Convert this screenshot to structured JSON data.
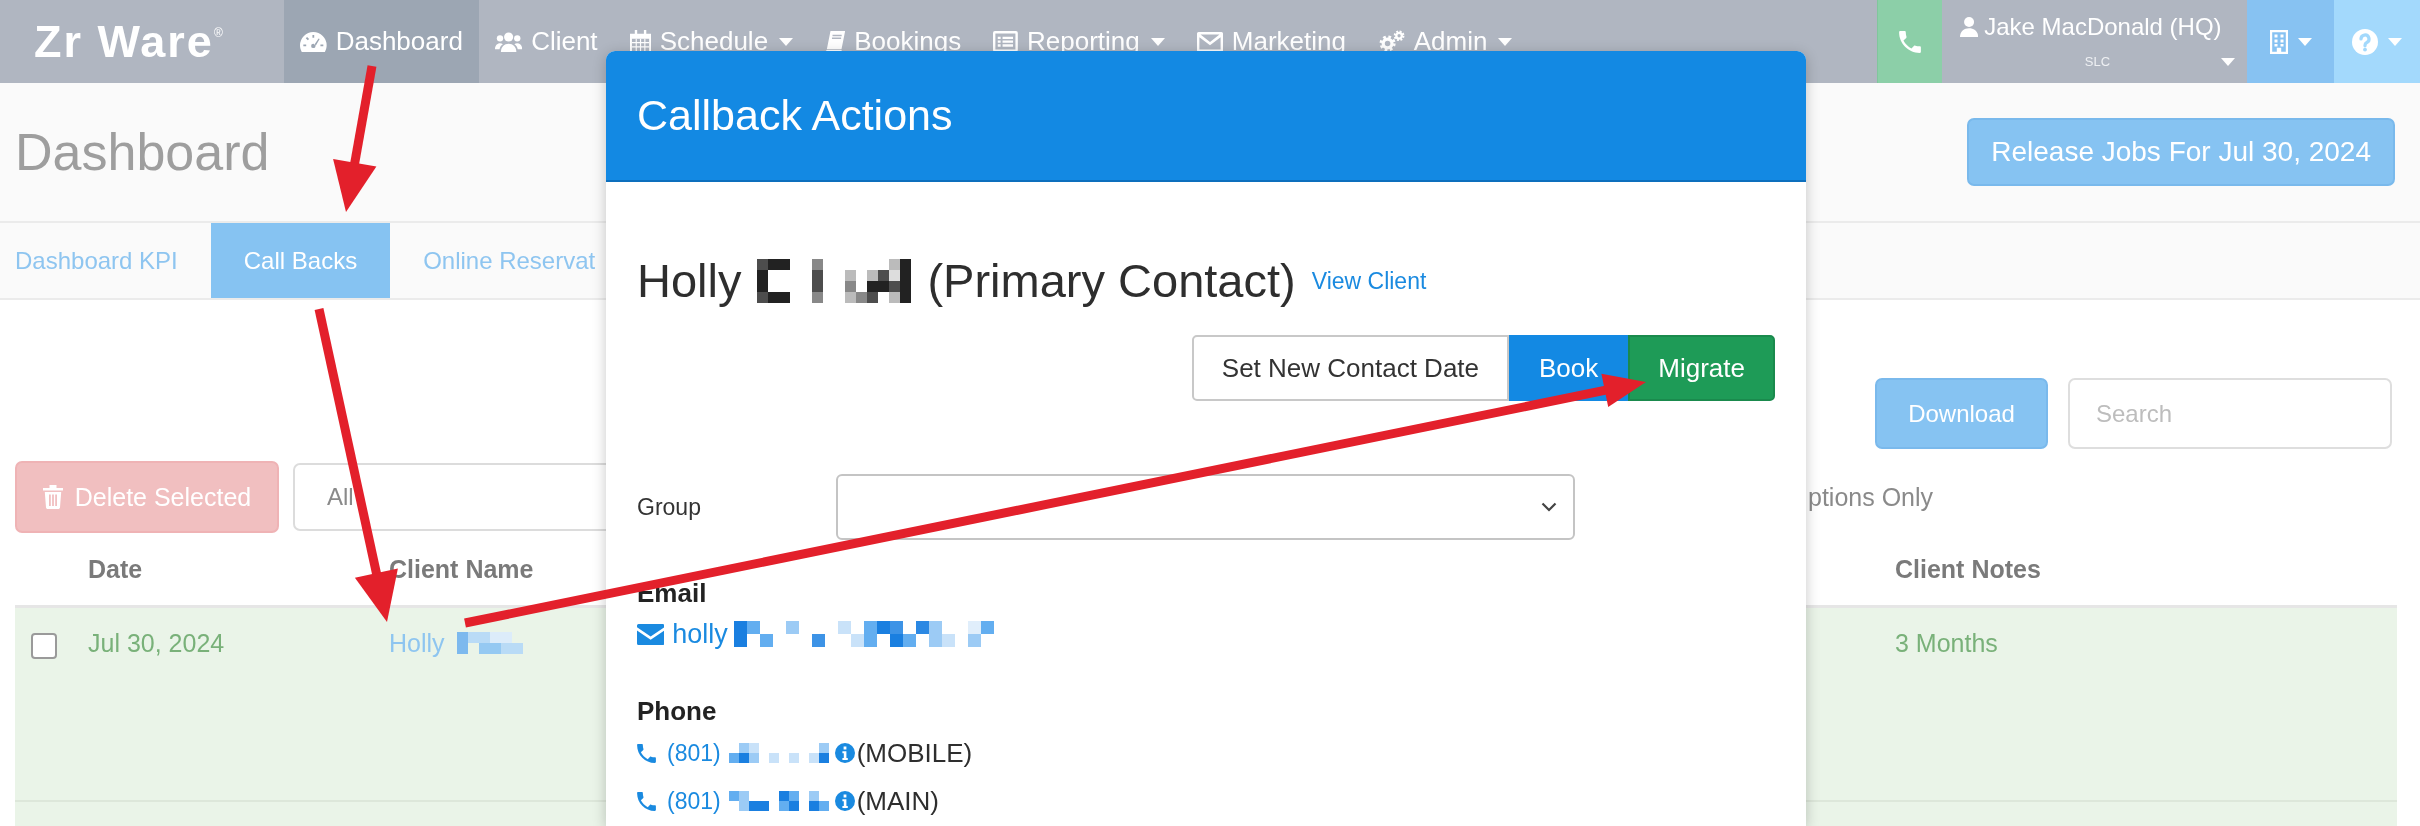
{
  "navbar": {
    "brand": "Zr Ware$^{®}$",
    "items": [
      {
        "label": "Dashboard",
        "selected": true,
        "dropdown": false
      },
      {
        "label": "Client",
        "selected": false,
        "dropdown": false
      },
      {
        "label": "Schedule",
        "selected": false,
        "dropdown": true
      },
      {
        "label": "Bookings",
        "selected": false,
        "dropdown": false
      },
      {
        "label": "Reporting",
        "selected": false,
        "dropdown": true
      },
      {
        "label": "Marketing",
        "selected": false,
        "dropdown": false
      },
      {
        "label": "Admin",
        "selected": false,
        "dropdown": true
      }
    ],
    "user": {
      "name": "Jake MacDonald (HQ)",
      "location": "SLC"
    }
  },
  "page": {
    "title": "Dashboard",
    "release_button": "Release Jobs For Jul 30, 2024"
  },
  "tabs": [
    {
      "label": "Dashboard KPI",
      "selected": false
    },
    {
      "label": "Call Backs",
      "selected": true
    },
    {
      "label": "Online Reservat",
      "selected": false
    }
  ],
  "toolbar": {
    "download_button": "Download",
    "search": {
      "placeholder": "Search"
    },
    "delete_button": "Delete Selected",
    "filter": {
      "value": "All"
    },
    "option_label": "ptions Only"
  },
  "table": {
    "columns": [
      "Date",
      "Client Name",
      "Client Notes"
    ],
    "rows": [
      {
        "checked": false,
        "date": "Jul 30, 2024",
        "client_name": "Holly",
        "redacted": true,
        "client_notes": "3 Months"
      }
    ]
  },
  "modal": {
    "title": "Callback Actions",
    "contact": {
      "first_name": "Holly",
      "redacted": true,
      "role": "(Primary Contact)"
    },
    "view_client_link": "View Client",
    "buttons": [
      {
        "label": "Set New Contact Date",
        "kind": "default"
      },
      {
        "label": "Book",
        "kind": "primary"
      },
      {
        "label": "Migrate",
        "kind": "success"
      }
    ],
    "group": {
      "label": "Group"
    },
    "email": {
      "label": "Email",
      "address": "holly",
      "redacted": true
    },
    "phone": {
      "label": "Phone",
      "numbers": [
        {
          "area_code": "(801)",
          "redacted": true,
          "type": "(MOBILE)"
        },
        {
          "area_code": "(801)",
          "redacted": true,
          "type": "(MAIN)"
        }
      ]
    }
  },
  "annotations": [
    {
      "kind": "arrow"
    },
    {
      "kind": "arrow"
    },
    {
      "kind": "arrow"
    }
  ]
}
